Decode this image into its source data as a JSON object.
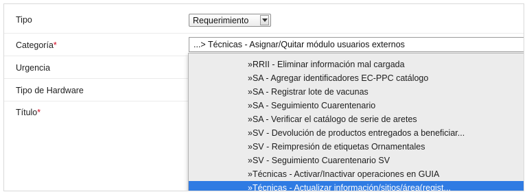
{
  "form": {
    "tipo": {
      "label": "Tipo",
      "value": "Requerimiento"
    },
    "categoria": {
      "label": "Categoría",
      "required_mark": "*",
      "value": "...> Técnicas - Asignar/Quitar módulo usuarios externos"
    },
    "urgencia": {
      "label": "Urgencia"
    },
    "tipo_hardware": {
      "label": "Tipo de Hardware"
    },
    "titulo": {
      "label": "Título",
      "required_mark": "*"
    }
  },
  "dropdown": {
    "items": [
      "»RRII - Eliminar información mal cargada",
      "»SA - Agregar identificadores EC-PPC catálogo",
      "»SA - Registrar lote de vacunas",
      "»SA - Seguimiento Cuarentenario",
      "»SA - Verificar el catálogo de serie de aretes",
      "»SV - Devolución de productos entregados a beneficiar...",
      "»SV - Reimpresión de etiquetas Ornamentales",
      "»SV - Seguimiento Cuarentenario SV",
      "»Técnicas - Activar/Inactivar operaciones en GUIA",
      "»Técnicas - Actualizar información/sitios/área(regist..."
    ],
    "selected_index": 9
  },
  "colors": {
    "highlight": "#2f7be3",
    "required": "#d0021b"
  }
}
